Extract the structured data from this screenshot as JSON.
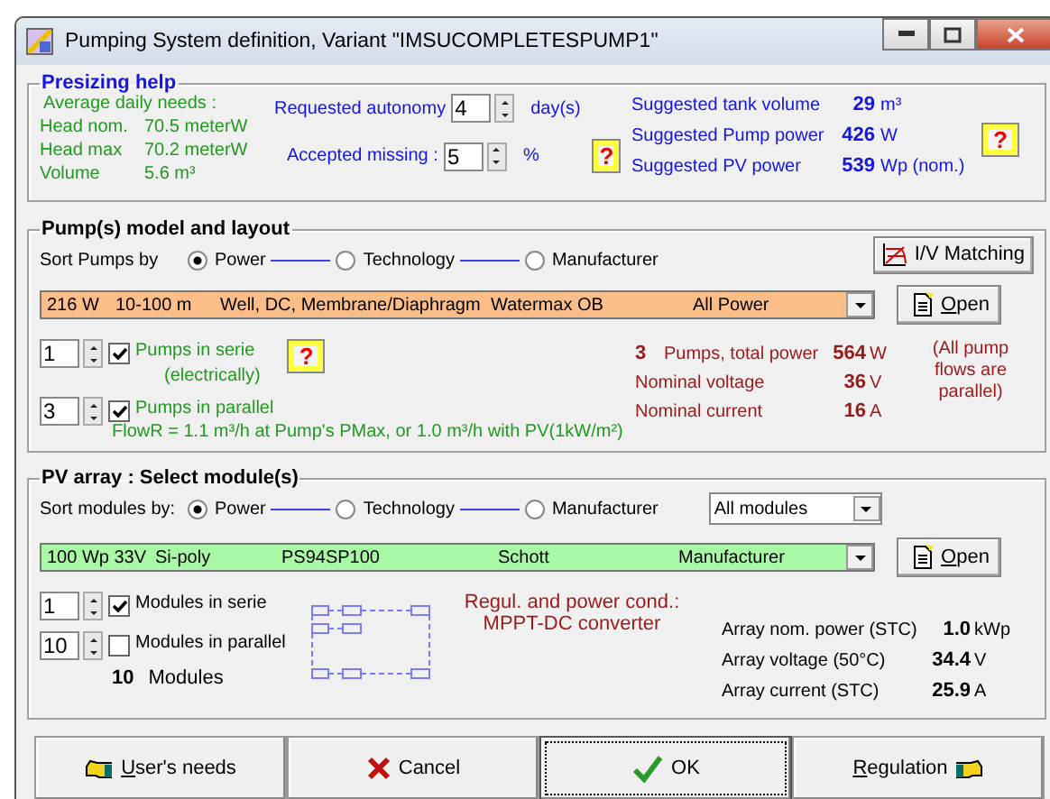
{
  "window": {
    "title": "Pumping System definition, Variant  \"IMSUCOMPLETESPUMP1\""
  },
  "presizing": {
    "title": "Presizing help",
    "needs_label": "Average daily needs :",
    "needs": [
      {
        "label": "Head nom.",
        "value": "70.5 meterW"
      },
      {
        "label": "Head max",
        "value": "70.2 meterW"
      },
      {
        "label": "Volume",
        "value": "5.6 m³"
      }
    ],
    "autonomy": {
      "label": "Requested autonomy",
      "value": "4",
      "unit": "day(s)"
    },
    "missing": {
      "label": "Accepted missing :",
      "value": "5",
      "unit": "%"
    },
    "help_button": "?",
    "suggested": [
      {
        "label": "Suggested tank volume",
        "value": "29",
        "unit": "m³"
      },
      {
        "label": "Suggested Pump power",
        "value": "426",
        "unit": "W"
      },
      {
        "label": "Suggested PV power",
        "value": "539",
        "unit": "Wp (nom.)"
      }
    ],
    "help_button_2": "?"
  },
  "pumps": {
    "title": "Pump(s)  model and layout",
    "sort_label": "Sort Pumps by",
    "sort_options": [
      {
        "label": "Power",
        "selected": true
      },
      {
        "label": "Technology",
        "selected": false
      },
      {
        "label": "Manufacturer",
        "selected": false
      }
    ],
    "iv_button": "I/V Matching",
    "selector": [
      "216 W",
      "10-100 m",
      "Well, DC, Membrane/Diaphragm",
      "Watermax OB",
      "All Power"
    ],
    "open_button": "Open",
    "serie": {
      "value": "1",
      "checked": true,
      "label": "Pumps in serie",
      "sublabel": "(electrically)"
    },
    "help_button": "?",
    "parallel": {
      "value": "3",
      "checked": true,
      "label": "Pumps in parallel",
      "note": "FlowR = 1.1 m³/h at Pump's PMax, or 1.0 m³/h with PV(1kW/m²)"
    },
    "count": "3",
    "results": [
      {
        "label": "Pumps,  total power",
        "value": "564",
        "unit": "W"
      },
      {
        "label": "Nominal voltage",
        "value": "36",
        "unit": "V"
      },
      {
        "label": "Nominal current",
        "value": "16",
        "unit": "A"
      }
    ],
    "note": "(All pump flows are parallel)"
  },
  "pv": {
    "title": "PV array : Select module(s)",
    "sort_label": "Sort modules by:",
    "sort_options": [
      {
        "label": "Power",
        "selected": true
      },
      {
        "label": "Technology",
        "selected": false
      },
      {
        "label": "Manufacturer",
        "selected": false
      }
    ],
    "filter": "All modules",
    "selector": [
      "100 Wp 33V",
      "Si-poly",
      "PS94SP100",
      "Schott",
      "Manufacturer"
    ],
    "open_button": "Open",
    "serie": {
      "value": "1",
      "checked": true,
      "label": "Modules in serie"
    },
    "parallel": {
      "value": "10",
      "checked": false,
      "label": "Modules in parallel"
    },
    "total": {
      "count": "10",
      "label": "Modules"
    },
    "regul": "Regul. and power cond.:",
    "converter": "MPPT-DC converter",
    "results": [
      {
        "label": "Array nom. power (STC)",
        "value": "1.0",
        "unit": "kWp"
      },
      {
        "label": "Array voltage  (50°C)",
        "value": "34.4",
        "unit": "V"
      },
      {
        "label": "Array current  (STC)",
        "value": "25.9",
        "unit": "A"
      }
    ]
  },
  "buttons": [
    {
      "label": "User's needs",
      "kind": "back",
      "focused": false
    },
    {
      "label": "Cancel",
      "kind": "cancel",
      "focused": false
    },
    {
      "label": "OK",
      "kind": "ok",
      "focused": true
    },
    {
      "label": "Regulation",
      "kind": "next",
      "focused": false
    }
  ]
}
